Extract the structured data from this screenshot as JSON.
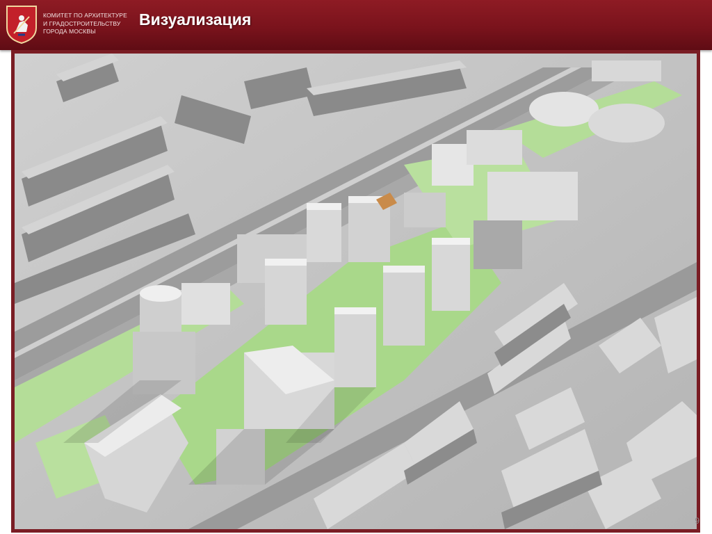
{
  "header": {
    "org_lines": [
      "КОМИТЕТ ПО АРХИТЕКТУРЕ",
      "И ГРАДОСТРОИТЕЛЬСТВУ",
      "ГОРОДА МОСКВЫ"
    ],
    "title": "Визуализация",
    "logo_icon": "moscow-coat-of-arms-icon"
  },
  "slide": {
    "page_number": "9",
    "image_icon": "city-district-3d-render"
  },
  "colors": {
    "header_bg": "#7a131c",
    "frame": "#7a1d24",
    "lawn": "#a9d88a",
    "road": "#9a9a9a",
    "building": "#e2e2e2"
  }
}
